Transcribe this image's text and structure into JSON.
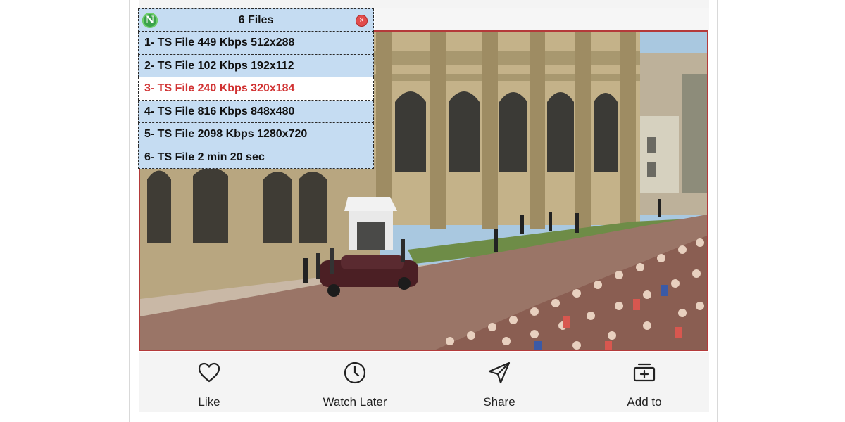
{
  "playlist": {
    "title": "6 Files",
    "logo_letter": "N",
    "close_glyph": "×",
    "items": [
      {
        "label": "1- TS File 449 Kbps 512x288",
        "active": false
      },
      {
        "label": "2- TS File 102 Kbps 192x112",
        "active": false
      },
      {
        "label": "3- TS File 240 Kbps 320x184",
        "active": true
      },
      {
        "label": "4- TS File 816 Kbps 848x480",
        "active": false
      },
      {
        "label": "5- TS File 2098 Kbps 1280x720",
        "active": false
      },
      {
        "label": "6- TS File 2 min 20 sec",
        "active": false
      }
    ]
  },
  "actions": {
    "like": {
      "label": "Like",
      "icon": "heart-icon"
    },
    "watch_later": {
      "label": "Watch Later",
      "icon": "clock-icon"
    },
    "share": {
      "label": "Share",
      "icon": "send-icon"
    },
    "add_to": {
      "label": "Add to",
      "icon": "add-to-playlist-icon"
    }
  },
  "colors": {
    "overlay_bg": "#c5dcf2",
    "active_text": "#d13232",
    "video_border": "#b43a3a"
  }
}
